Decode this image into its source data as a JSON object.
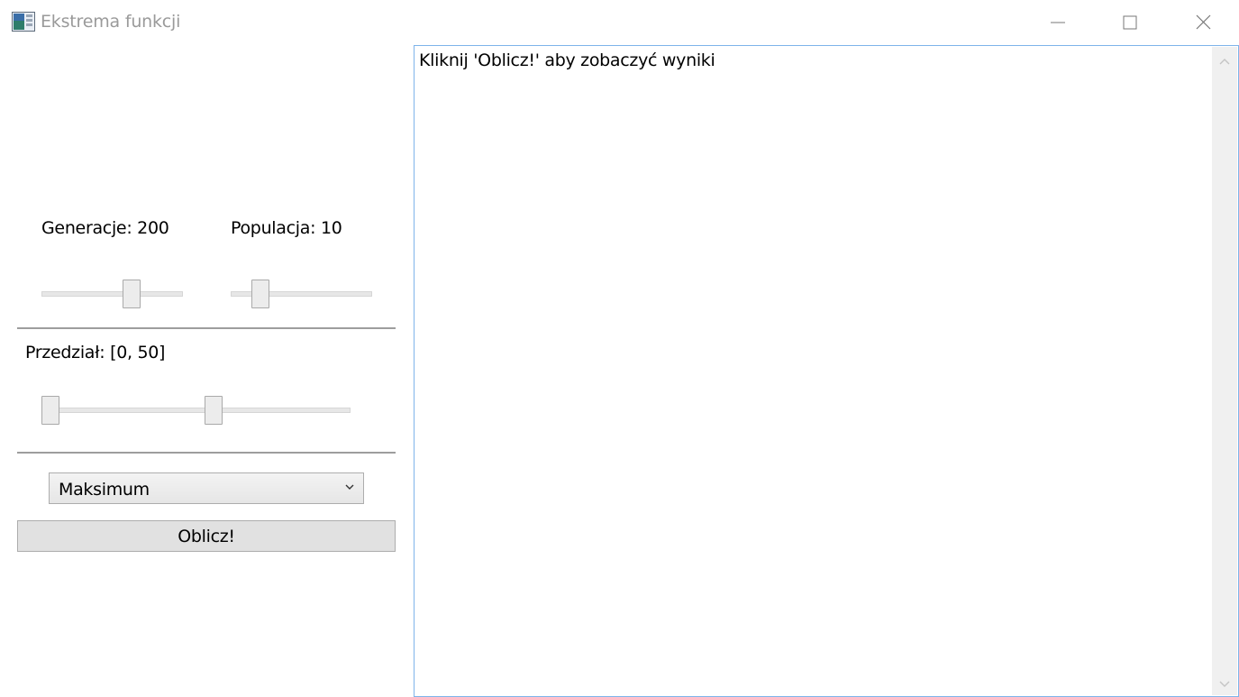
{
  "window": {
    "title": "Ekstrema funkcji",
    "controls": [
      "minimize-icon",
      "maximize-icon",
      "close-icon"
    ]
  },
  "params": {
    "generations_label": "Generacje: 200",
    "generations_slider_fraction": 0.66,
    "population_label": "Populacja: 10",
    "population_slider_fraction": 0.17,
    "interval_label": "Przedział: [0, 50]",
    "interval_low_fraction": 0.0,
    "interval_high_fraction": 0.56
  },
  "mode": {
    "selected": "Maksimum"
  },
  "actions": {
    "compute_label": "Oblicz!"
  },
  "output": {
    "text": "Kliknij 'Oblicz!' aby zobaczyć wyniki"
  },
  "colors": {
    "output_border": "#7eb4ea",
    "button_bg": "#e1e1e1"
  }
}
